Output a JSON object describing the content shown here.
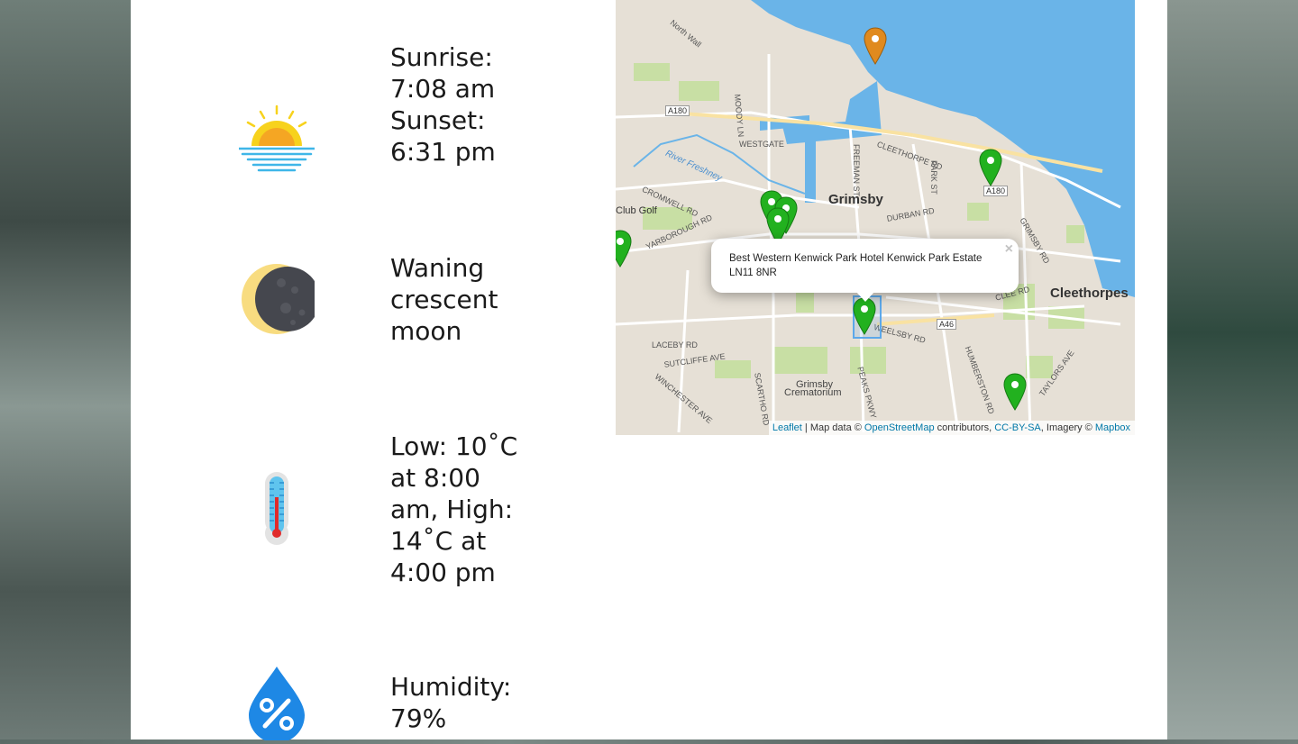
{
  "weather": {
    "sun": {
      "sunrise_label": "Sunrise:",
      "sunrise_time": "7:08 am",
      "sunset_label": "Sunset:",
      "sunset_time": "6:31 pm"
    },
    "moon": {
      "line1": "Waning",
      "line2": "crescent",
      "line3": "moon"
    },
    "temperature": {
      "line1": "Low: 10˚C",
      "line2": "at 8:00",
      "line3": "am, High:",
      "line4": "14˚C at",
      "line5": "4:00 pm"
    },
    "humidity": {
      "line1": "Humidity:",
      "line2": "79%"
    }
  },
  "icons": {
    "sun": "sunrise-icon",
    "moon": "waning-crescent-moon-icon",
    "temperature": "thermometer-icon",
    "humidity": "humidity-drop-icon"
  },
  "colors": {
    "marker_green": "#22b11f",
    "marker_orange": "#e08a1e",
    "water": "#6ab4e8",
    "link": "#0078a8"
  },
  "map": {
    "labels": {
      "grimsby": "Grimsby",
      "cleethorpes": "Cleethorpes",
      "crematorium_1": "Grimsby",
      "crematorium_2": "Crematorium",
      "club_golf": "Club Golf",
      "river": "River Freshney",
      "north_wall": "North Wall",
      "westgate": "WESTGATE",
      "cromwell": "CROMWELL RD",
      "yarborough": "YARBOROUGH RD",
      "cleethorpe_rd": "CLEETHORPE RD",
      "freeman": "FREEMAN ST",
      "park_st": "PARK ST",
      "grimsby_rd": "GRIMSBY RD",
      "durban": "DURBAN RD",
      "weelsby": "WEELSBY RD",
      "laceby": "LACEBY RD",
      "sutcliffe": "SUTCLIFFE AVE",
      "winchester": "WINCHESTER AVE",
      "scartho": "SCARTHO RD",
      "peaks": "PEAKS PKWY",
      "humberston": "HUMBERSTON RD",
      "taylors": "TAYLORS AVE",
      "clee": "CLEE RD",
      "moody": "MOODY LN",
      "a180_1": "A180",
      "a180_2": "A180",
      "a46": "A46"
    },
    "popup": {
      "line1": "Best Western Kenwick Park Hotel Kenwick Park Estate",
      "line2": "LN11 8NR",
      "close": "×"
    },
    "attribution": {
      "leaflet": "Leaflet",
      "sep1": " | Map data © ",
      "osm": "OpenStreetMap",
      "sep2": " contributors, ",
      "license": "CC-BY-SA",
      "sep3": ", Imagery © ",
      "mapbox": "Mapbox"
    }
  }
}
